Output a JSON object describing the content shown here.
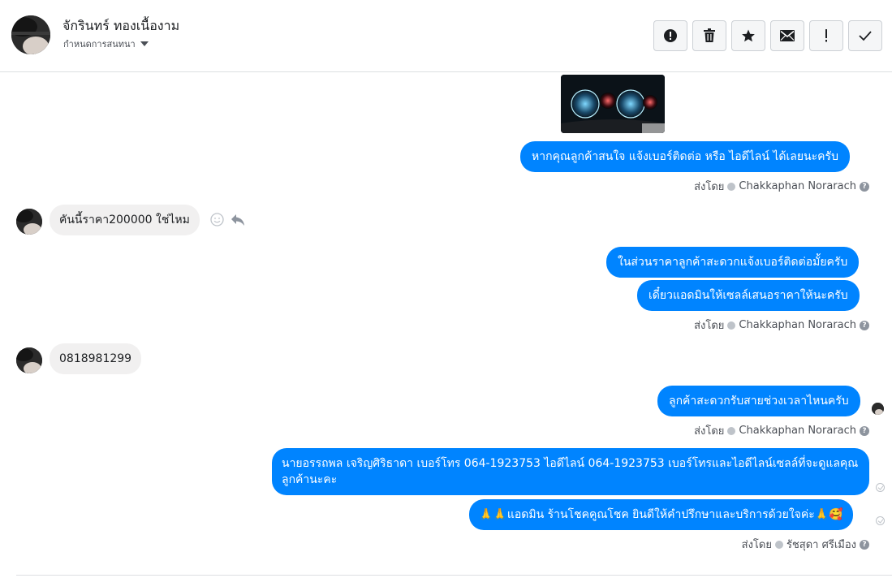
{
  "header": {
    "contact_name": "จักรินทร์ ทองเนื้องาม",
    "assign_label": "กำหนดการสนทนา",
    "toolbar": [
      {
        "icon": "alert-circle-icon",
        "name": "mark-spam-button"
      },
      {
        "icon": "trash-icon",
        "name": "delete-button"
      },
      {
        "icon": "star-icon",
        "name": "star-button"
      },
      {
        "icon": "envelope-icon",
        "name": "mark-unread-button"
      },
      {
        "icon": "exclamation-icon",
        "name": "follow-up-button"
      },
      {
        "icon": "checkmark-icon",
        "name": "mark-done-button"
      }
    ]
  },
  "messages": {
    "m1": "หากคุณลูกค้าสนใจ แจ้งเบอร์ติดต่อ หรือ ไอดีไลน์ ได้เลยนะครับ",
    "m2": "คันนี้ราคา200000 ใช่ไหม",
    "m3": "ในส่วนราคาลูกค้าสะดวกแจ้งเบอร์ติดต่อมั้ยครับ",
    "m4": "เดี๋ยวแอดมินให้เซลล์เสนอราคาให้นะครับ",
    "m5": "0818981299",
    "m6": "ลูกค้าสะดวกรับสายช่วงเวลาไหนครับ",
    "m7": "นายอรรถพล เจริญศิริธาดา     เบอร์โทร 064-1923753 ไอดีไลน์ 064-1923753   เบอร์โทรและไอดีไลน์เซลล์ที่จะดูแลคุณลูกค้านะคะ",
    "m8": "🙏🙏แอดมิน ร้านโชคคูณโชค ยินดีให้คำปรึกษาและบริการด้วยใจค่ะ🙏🥰"
  },
  "sent_by": {
    "prefix": "ส่งโดย",
    "agent_1": "Chakkaphan Norarach",
    "agent_2": "รัชสุดา ศรีเมือง",
    "help_glyph": "?"
  },
  "colors": {
    "outgoing_bubble": "#0084ff",
    "incoming_bubble": "#f1f0f0",
    "divider": "#dddfe2"
  }
}
